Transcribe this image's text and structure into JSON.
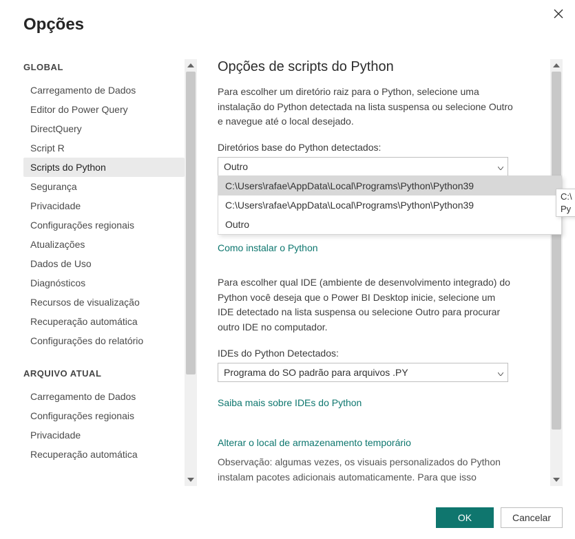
{
  "dialog": {
    "title": "Opções"
  },
  "sidebar": {
    "sections": [
      {
        "header": "GLOBAL",
        "items": [
          "Carregamento de Dados",
          "Editor do Power Query",
          "DirectQuery",
          "Script R",
          "Scripts do Python",
          "Segurança",
          "Privacidade",
          "Configurações regionais",
          "Atualizações",
          "Dados de Uso",
          "Diagnósticos",
          "Recursos de visualização",
          "Recuperação automática",
          "Configurações do relatório"
        ],
        "selected_index": 4
      },
      {
        "header": "ARQUIVO ATUAL",
        "items": [
          "Carregamento de Dados",
          "Configurações regionais",
          "Privacidade",
          "Recuperação automática"
        ]
      }
    ]
  },
  "main": {
    "heading": "Opções de scripts do Python",
    "intro": "Para escolher um diretório raiz para o Python, selecione uma instalação do Python detectada na lista suspensa ou selecione Outro e navegue até o local desejado.",
    "dir_label": "Diretórios base do Python detectados:",
    "dir_selected": "Outro",
    "dir_options": [
      "C:\\Users\\rafae\\AppData\\Local\\Programs\\Python\\Python39",
      "C:\\Users\\rafae\\AppData\\Local\\Programs\\Python\\Python39",
      "Outro"
    ],
    "dir_hovered_index": 0,
    "tooltip_line1": "C:\\",
    "tooltip_line2": "Py",
    "install_link": "Como instalar o Python",
    "ide_intro": "Para escolher qual IDE (ambiente de desenvolvimento integrado) do Python você deseja que o Power BI Desktop inicie, selecione um IDE detectado na lista suspensa ou selecione Outro para procurar outro IDE no computador.",
    "ide_label": "IDEs do Python Detectados:",
    "ide_selected": "Programa do SO padrão para arquivos .PY",
    "ide_link": "Saiba mais sobre IDEs do Python",
    "temp_heading": "Alterar o local de armazenamento temporário",
    "temp_note": "Observação: algumas vezes, os visuais personalizados do Python instalam pacotes adicionais automaticamente. Para que isso"
  },
  "footer": {
    "ok": "OK",
    "cancel": "Cancelar"
  }
}
